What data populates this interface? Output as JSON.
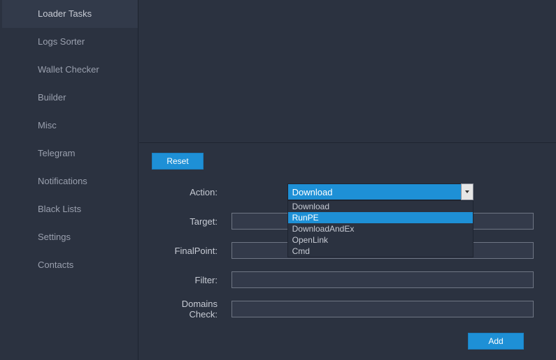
{
  "sidebar": {
    "items": [
      {
        "label": "Loader Tasks",
        "active": true
      },
      {
        "label": "Logs Sorter",
        "active": false
      },
      {
        "label": "Wallet Checker",
        "active": false
      },
      {
        "label": "Builder",
        "active": false
      },
      {
        "label": "Misc",
        "active": false
      },
      {
        "label": "Telegram",
        "active": false
      },
      {
        "label": "Notifications",
        "active": false
      },
      {
        "label": "Black Lists",
        "active": false
      },
      {
        "label": "Settings",
        "active": false
      },
      {
        "label": "Contacts",
        "active": false
      }
    ]
  },
  "buttons": {
    "reset": "Reset",
    "add": "Add"
  },
  "form": {
    "action_label": "Action:",
    "target_label": "Target:",
    "finalpoint_label": "FinalPoint:",
    "filter_label": "Filter:",
    "domains_label": "Domains Check:",
    "action_value": "Download",
    "target_value": "",
    "finalpoint_value": "",
    "filter_value": "",
    "domains_value": ""
  },
  "dropdown": {
    "options": [
      {
        "label": "Download",
        "highlight": false
      },
      {
        "label": "RunPE",
        "highlight": true
      },
      {
        "label": "DownloadAndEx",
        "highlight": false
      },
      {
        "label": "OpenLink",
        "highlight": false
      },
      {
        "label": "Cmd",
        "highlight": false
      }
    ]
  }
}
